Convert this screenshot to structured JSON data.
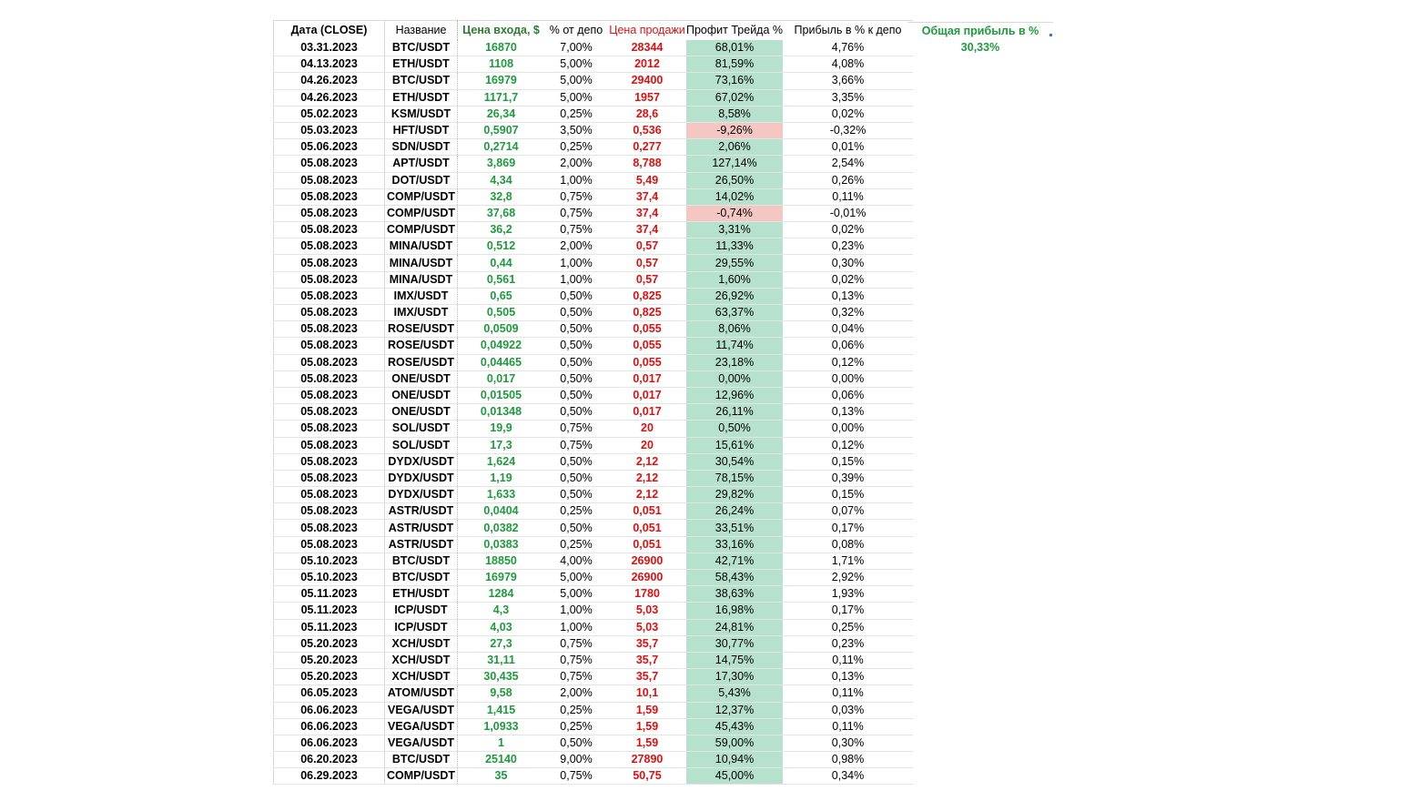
{
  "headers": {
    "date": "Дата (CLOSE)",
    "name": "Название",
    "entry": "Цена входа, $",
    "pct": "% от депо",
    "sell": "Цена продажи",
    "profit": "Профит Трейда %",
    "dep": "Прибыль в % к депо"
  },
  "total": {
    "label": "Общая прибыль в %",
    "value": "30,33%"
  },
  "rows": [
    [
      "03.31.2023",
      "BTC/USDT",
      "16870",
      "7,00%",
      "28344",
      "68,01%",
      "4,76%"
    ],
    [
      "04.13.2023",
      "ETH/USDT",
      "1108",
      "5,00%",
      "2012",
      "81,59%",
      "4,08%"
    ],
    [
      "04.26.2023",
      "BTC/USDT",
      "16979",
      "5,00%",
      "29400",
      "73,16%",
      "3,66%"
    ],
    [
      "04.26.2023",
      "ETH/USDT",
      "1171,7",
      "5,00%",
      "1957",
      "67,02%",
      "3,35%"
    ],
    [
      "05.02.2023",
      "KSM/USDT",
      "26,34",
      "0,25%",
      "28,6",
      "8,58%",
      "0,02%"
    ],
    [
      "05.03.2023",
      "HFT/USDT",
      "0,5907",
      "3,50%",
      "0,536",
      "-9,26%",
      "-0,32%"
    ],
    [
      "05.06.2023",
      "SDN/USDT",
      "0,2714",
      "0,25%",
      "0,277",
      "2,06%",
      "0,01%"
    ],
    [
      "05.08.2023",
      "APT/USDT",
      "3,869",
      "2,00%",
      "8,788",
      "127,14%",
      "2,54%"
    ],
    [
      "05.08.2023",
      "DOT/USDT",
      "4,34",
      "1,00%",
      "5,49",
      "26,50%",
      "0,26%"
    ],
    [
      "05.08.2023",
      "COMP/USDT",
      "32,8",
      "0,75%",
      "37,4",
      "14,02%",
      "0,11%"
    ],
    [
      "05.08.2023",
      "COMP/USDT",
      "37,68",
      "0,75%",
      "37,4",
      "-0,74%",
      "-0,01%"
    ],
    [
      "05.08.2023",
      "COMP/USDT",
      "36,2",
      "0,75%",
      "37,4",
      "3,31%",
      "0,02%"
    ],
    [
      "05.08.2023",
      "MINA/USDT",
      "0,512",
      "2,00%",
      "0,57",
      "11,33%",
      "0,23%"
    ],
    [
      "05.08.2023",
      "MINA/USDT",
      "0,44",
      "1,00%",
      "0,57",
      "29,55%",
      "0,30%"
    ],
    [
      "05.08.2023",
      "MINA/USDT",
      "0,561",
      "1,00%",
      "0,57",
      "1,60%",
      "0,02%"
    ],
    [
      "05.08.2023",
      "IMX/USDT",
      "0,65",
      "0,50%",
      "0,825",
      "26,92%",
      "0,13%"
    ],
    [
      "05.08.2023",
      "IMX/USDT",
      "0,505",
      "0,50%",
      "0,825",
      "63,37%",
      "0,32%"
    ],
    [
      "05.08.2023",
      "ROSE/USDT",
      "0,0509",
      "0,50%",
      "0,055",
      "8,06%",
      "0,04%"
    ],
    [
      "05.08.2023",
      "ROSE/USDT",
      "0,04922",
      "0,50%",
      "0,055",
      "11,74%",
      "0,06%"
    ],
    [
      "05.08.2023",
      "ROSE/USDT",
      "0,04465",
      "0,50%",
      "0,055",
      "23,18%",
      "0,12%"
    ],
    [
      "05.08.2023",
      "ONE/USDT",
      "0,017",
      "0,50%",
      "0,017",
      "0,00%",
      "0,00%"
    ],
    [
      "05.08.2023",
      "ONE/USDT",
      "0,01505",
      "0,50%",
      "0,017",
      "12,96%",
      "0,06%"
    ],
    [
      "05.08.2023",
      "ONE/USDT",
      "0,01348",
      "0,50%",
      "0,017",
      "26,11%",
      "0,13%"
    ],
    [
      "05.08.2023",
      "SOL/USDT",
      "19,9",
      "0,75%",
      "20",
      "0,50%",
      "0,00%"
    ],
    [
      "05.08.2023",
      "SOL/USDT",
      "17,3",
      "0,75%",
      "20",
      "15,61%",
      "0,12%"
    ],
    [
      "05.08.2023",
      "DYDX/USDT",
      "1,624",
      "0,50%",
      "2,12",
      "30,54%",
      "0,15%"
    ],
    [
      "05.08.2023",
      "DYDX/USDT",
      "1,19",
      "0,50%",
      "2,12",
      "78,15%",
      "0,39%"
    ],
    [
      "05.08.2023",
      "DYDX/USDT",
      "1,633",
      "0,50%",
      "2,12",
      "29,82%",
      "0,15%"
    ],
    [
      "05.08.2023",
      "ASTR/USDT",
      "0,0404",
      "0,25%",
      "0,051",
      "26,24%",
      "0,07%"
    ],
    [
      "05.08.2023",
      "ASTR/USDT",
      "0,0382",
      "0,50%",
      "0,051",
      "33,51%",
      "0,17%"
    ],
    [
      "05.08.2023",
      "ASTR/USDT",
      "0,0383",
      "0,25%",
      "0,051",
      "33,16%",
      "0,08%"
    ],
    [
      "05.10.2023",
      "BTC/USDT",
      "18850",
      "4,00%",
      "26900",
      "42,71%",
      "1,71%"
    ],
    [
      "05.10.2023",
      "BTC/USDT",
      "16979",
      "5,00%",
      "26900",
      "58,43%",
      "2,92%"
    ],
    [
      "05.11.2023",
      "ETH/USDT",
      "1284",
      "5,00%",
      "1780",
      "38,63%",
      "1,93%"
    ],
    [
      "05.11.2023",
      "ICP/USDT",
      "4,3",
      "1,00%",
      "5,03",
      "16,98%",
      "0,17%"
    ],
    [
      "05.11.2023",
      "ICP/USDT",
      "4,03",
      "1,00%",
      "5,03",
      "24,81%",
      "0,25%"
    ],
    [
      "05.20.2023",
      "XCH/USDT",
      "27,3",
      "0,75%",
      "35,7",
      "30,77%",
      "0,23%"
    ],
    [
      "05.20.2023",
      "XCH/USDT",
      "31,11",
      "0,75%",
      "35,7",
      "14,75%",
      "0,11%"
    ],
    [
      "05.20.2023",
      "XCH/USDT",
      "30,435",
      "0,75%",
      "35,7",
      "17,30%",
      "0,13%"
    ],
    [
      "06.05.2023",
      "ATOM/USDT",
      "9,58",
      "2,00%",
      "10,1",
      "5,43%",
      "0,11%"
    ],
    [
      "06.06.2023",
      "VEGA/USDT",
      "1,415",
      "0,25%",
      "1,59",
      "12,37%",
      "0,03%"
    ],
    [
      "06.06.2023",
      "VEGA/USDT",
      "1,0933",
      "0,25%",
      "1,59",
      "45,43%",
      "0,11%"
    ],
    [
      "06.06.2023",
      "VEGA/USDT",
      "1",
      "0,50%",
      "1,59",
      "59,00%",
      "0,30%"
    ],
    [
      "06.20.2023",
      "BTC/USDT",
      "25140",
      "9,00%",
      "27890",
      "10,94%",
      "0,98%"
    ],
    [
      "06.29.2023",
      "COMP/USDT",
      "35",
      "0,75%",
      "50,75",
      "45,00%",
      "0,34%"
    ]
  ],
  "colors": {
    "entry_green": "#1e9b3c",
    "sell_red": "#e01010",
    "profit_positive_bg": "#b6e1cd",
    "profit_negative_bg": "#f4c7c3"
  }
}
